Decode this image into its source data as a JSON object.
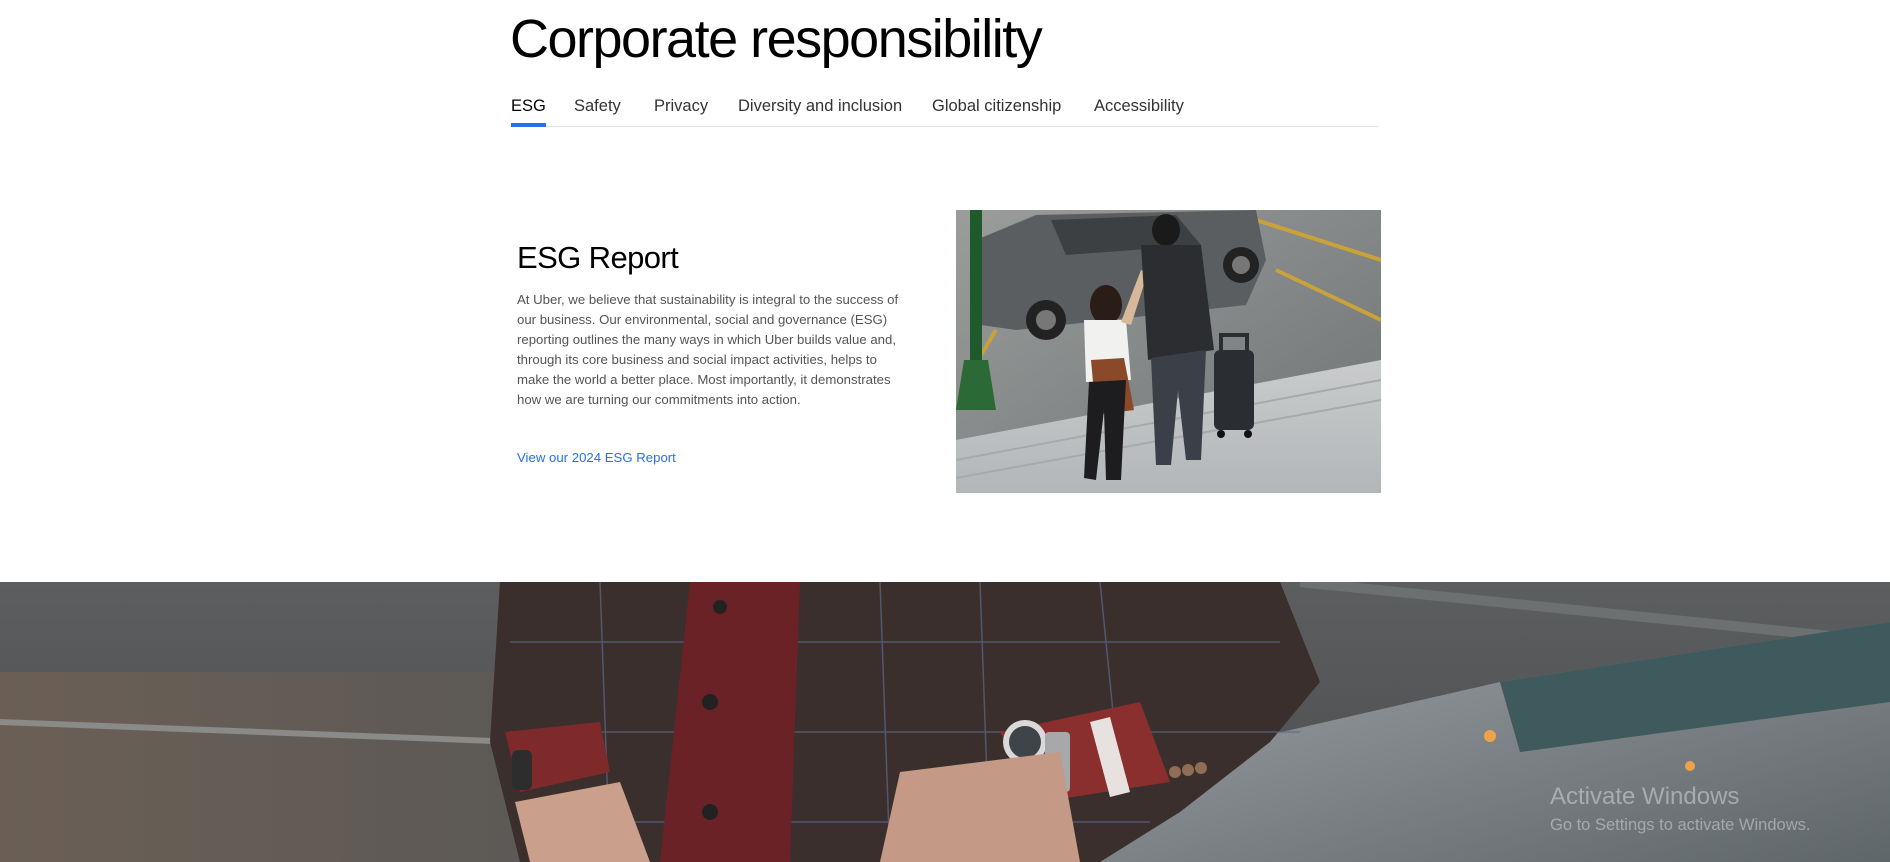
{
  "header": {
    "title": "Corporate responsibility"
  },
  "tabs": [
    {
      "label": "ESG",
      "active": true
    },
    {
      "label": "Safety",
      "active": false
    },
    {
      "label": "Privacy",
      "active": false
    },
    {
      "label": "Diversity and inclusion",
      "active": false
    },
    {
      "label": "Global citizenship",
      "active": false
    },
    {
      "label": "Accessibility",
      "active": false
    }
  ],
  "esg_section": {
    "title": "ESG Report",
    "body": "At Uber, we believe that sustainability is integral to the success of our business. Our environmental, social and governance (ESG) reporting outlines the many ways in which Uber builds value and, through its core business and social impact activities, helps to make the world a better place. Most importantly, it demonstrates how we are turning our commitments into action.",
    "link_label": "View our 2024 ESG Report"
  },
  "images": {
    "couple_photo": "couple-with-suitcase-photo",
    "banner_photo": "man-in-suit-leaning-on-car-photo"
  },
  "os_overlay": {
    "title": "Activate Windows",
    "subtitle": "Go to Settings to activate Windows."
  },
  "colors": {
    "accent": "#276ef1",
    "body_text": "#545454",
    "tab_text": "#333333",
    "divider": "#e2e2e2"
  }
}
